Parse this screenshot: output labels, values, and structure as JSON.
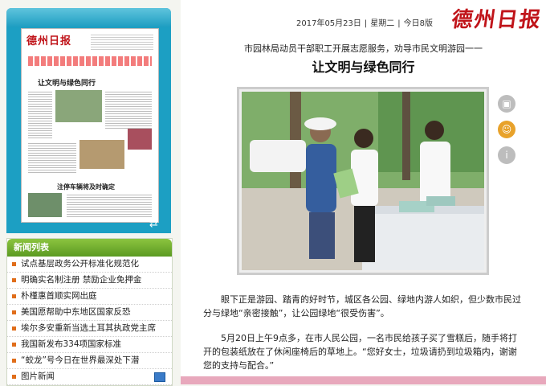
{
  "header": {
    "date": "2017年05月23日",
    "weekday": "星期二",
    "edition": "今日8版",
    "logo": "德州日报"
  },
  "thumbnail": {
    "logo": "德州日报",
    "headline": "让文明与绿色同行",
    "headline2": "注停车辆将及时确定",
    "refresh_icon": "refresh-icon"
  },
  "news_list": {
    "title": "新闻列表",
    "items": [
      "试点基层政务公开标准化规范化",
      "明确实名制注册 禁励企业免押金",
      "朴槿惠首顺实网出庭",
      "美国愿帮助中东地区国家反恐",
      "埃尔多安重新当选土耳其执政党主席",
      "我国新发布334项国家标准",
      "“蛟龙”号今日在世界最深处下潜",
      "图片新闻"
    ]
  },
  "article": {
    "subtitle": "市园林局动员干部职工开展志愿服务，劝导市民文明游园一一",
    "title": "让文明与绿色同行",
    "paragraphs": [
      "眼下正是游园、踏青的好时节，城区各公园、绿地内游人如织，但少数市民过分与绿地“亲密接触”，让公园绿地“很受伤害”。",
      "5月20日上午9点多，在市人民公园，一名市民给孩子买了雪糕后，随手将打开的包装纸放在了休闲座椅后的草地上。“您好女士，垃圾请扔到垃圾箱内，谢谢您的支持与配合。”"
    ]
  },
  "side_icons": [
    "camera-icon",
    "person-icon",
    "info-icon"
  ]
}
